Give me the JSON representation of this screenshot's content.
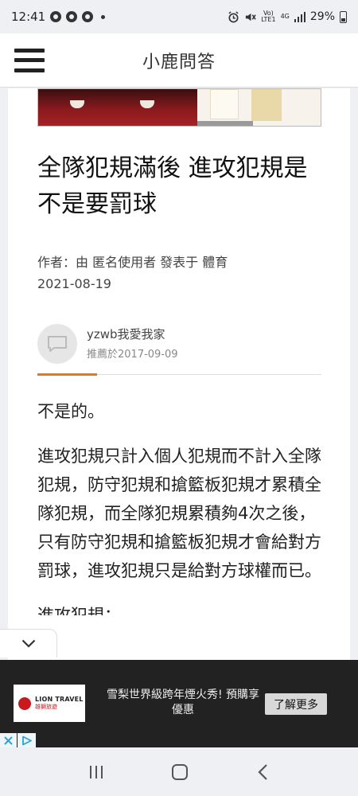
{
  "status_bar": {
    "time": "12:41",
    "battery": "29%",
    "network_top": "Vo)",
    "network_bottom": "LTE1",
    "network_gen": "4G"
  },
  "header": {
    "title": "小鹿問答"
  },
  "article": {
    "title": "全隊犯規滿後 進攻犯規是不是要罰球",
    "meta_line1": "作者：由 匿名使用者 發表于 體育",
    "meta_line2": "2021-08-19"
  },
  "answer": {
    "username": "yzwb我愛我家",
    "recommended": "推薦於2017-09-09",
    "paragraphs": [
      "不是的。",
      "進攻犯規只計入個人犯規而不計入全隊犯規，防守犯規和搶籃板犯規才累積全隊犯規，而全隊犯規累積夠4次之後，只有防守犯規和搶籃板犯規才會給對方罰球，進攻犯規只是給對方球權而已。",
      "進攻犯規："
    ]
  },
  "ad": {
    "brand_en": "LION TRAVEL",
    "brand_zh": "雄獅旅遊",
    "text": "雪梨世界級跨年煙火秀! 預購享優惠",
    "cta": "了解更多"
  },
  "colors": {
    "accent": "#e07b1a",
    "ad_background": "#222222",
    "page_background": "#eef0f3"
  }
}
